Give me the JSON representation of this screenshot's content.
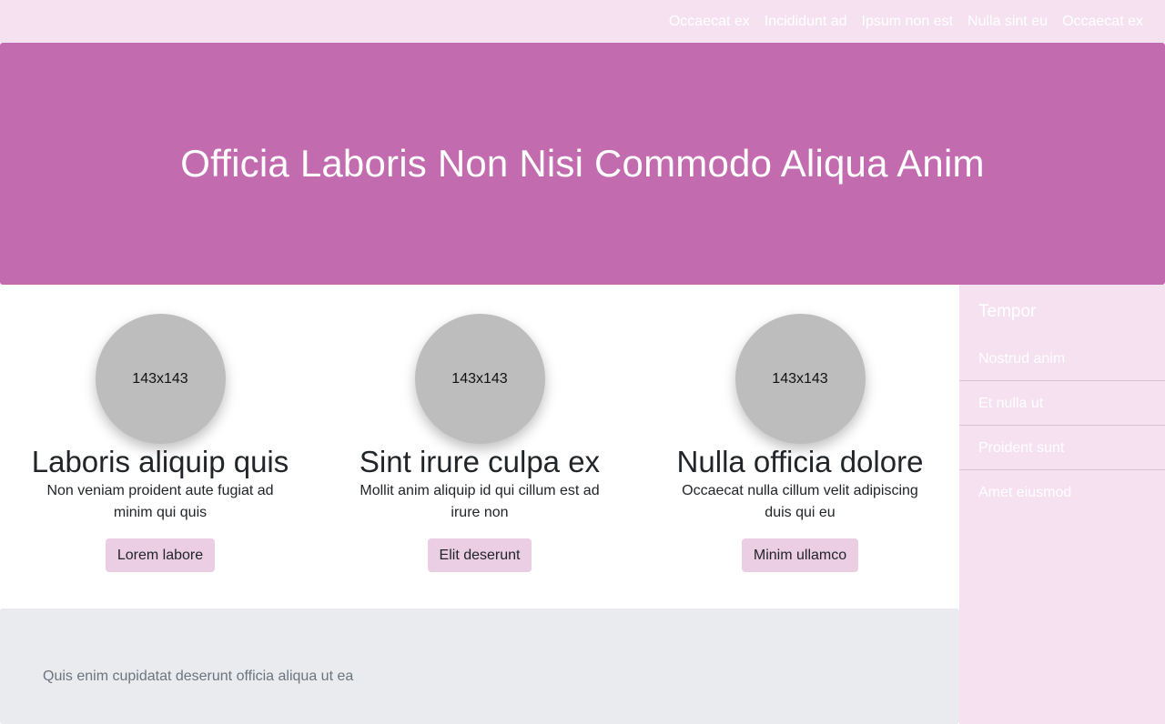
{
  "nav": {
    "links": [
      "Occaecat ex",
      "Incididunt ad",
      "Ipsum non est",
      "Nulla sint eu",
      "Occaecat ex"
    ]
  },
  "hero": {
    "title": "Officia Laboris Non Nisi Commodo Aliqua Anim"
  },
  "cards": [
    {
      "image_label": "143x143",
      "title": "Laboris aliquip quis",
      "text": "Non veniam proident aute fugiat ad minim qui quis",
      "button": "Lorem labore"
    },
    {
      "image_label": "143x143",
      "title": "Sint irure culpa ex",
      "text": "Mollit anim aliquip id qui cillum est ad irure non",
      "button": "Elit deserunt"
    },
    {
      "image_label": "143x143",
      "title": "Nulla officia dolore",
      "text": "Occaecat nulla cillum velit adipiscing duis qui eu",
      "button": "Minim ullamco"
    }
  ],
  "footer": {
    "text": "Quis enim cupidatat deserunt officia aliqua ut ea"
  },
  "sidebar": {
    "title": "Tempor",
    "items": [
      "Nostrud anim",
      "Et nulla ut",
      "Proident sunt",
      "Amet eiusmod"
    ]
  },
  "colors": {
    "nav_bg": "#f5e1f0",
    "hero_bg": "#c26baf",
    "button_bg": "#ebcde4",
    "footer_bg": "#e9ebef",
    "placeholder_bg": "#bdbdbd"
  }
}
